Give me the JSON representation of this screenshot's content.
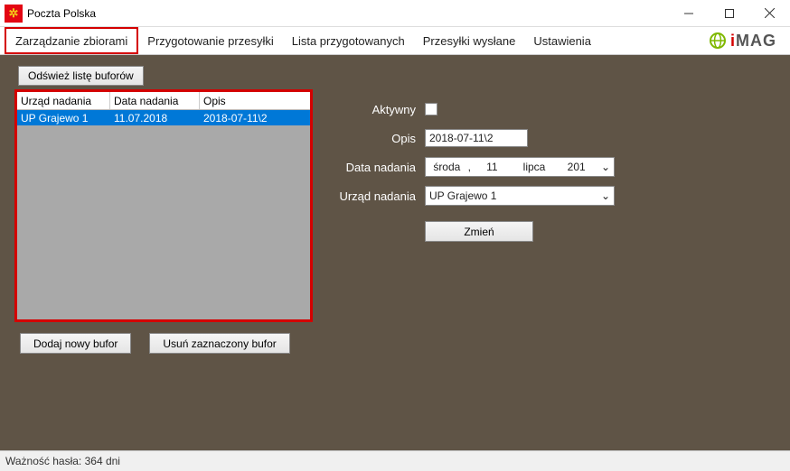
{
  "window": {
    "title": "Poczta Polska"
  },
  "menu": {
    "items": [
      "Zarządzanie zbiorami",
      "Przygotowanie przesyłki",
      "Lista przygotowanych",
      "Przesyłki wysłane",
      "Ustawienia"
    ],
    "active_index": 0
  },
  "logo_text": "iMAG",
  "buttons": {
    "refresh": "Odśwież listę buforów",
    "add": "Dodaj nowy bufor",
    "delete": "Usuń zaznaczony bufor",
    "change": "Zmień"
  },
  "table": {
    "headers": [
      "Urząd nadania",
      "Data nadania",
      "Opis"
    ],
    "rows": [
      {
        "office": "UP Grajewo 1",
        "date": "11.07.2018",
        "desc": "2018-07-11\\2"
      }
    ]
  },
  "form": {
    "labels": {
      "active": "Aktywny",
      "desc": "Opis",
      "date": "Data nadania",
      "office": "Urząd nadania"
    },
    "values": {
      "active": false,
      "desc": "2018-07-11\\2",
      "date_weekday": "środa",
      "date_day": "11",
      "date_month": "lipca",
      "date_year": "201",
      "office": "UP Grajewo 1"
    }
  },
  "status": "Ważność hasła: 364 dni"
}
